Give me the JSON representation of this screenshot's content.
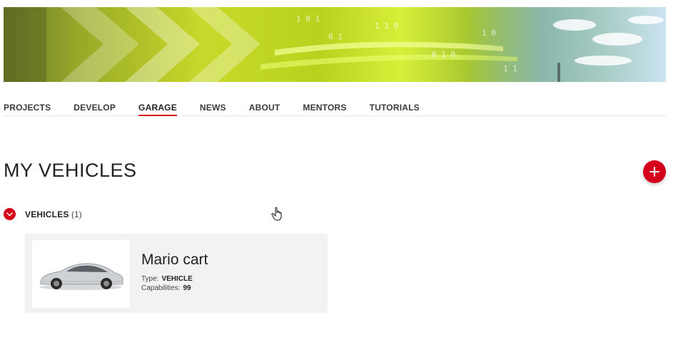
{
  "nav": {
    "items": [
      {
        "label": "PROJECTS"
      },
      {
        "label": "DEVELOP"
      },
      {
        "label": "GARAGE"
      },
      {
        "label": "NEWS"
      },
      {
        "label": "ABOUT"
      },
      {
        "label": "MENTORS"
      },
      {
        "label": "TUTORIALS"
      }
    ],
    "active": "GARAGE"
  },
  "page": {
    "title": "MY VEHICLES"
  },
  "add_button": {
    "icon": "plus-icon",
    "color": "#d5001c"
  },
  "section": {
    "label": "VEHICLES",
    "count": "(1)",
    "toggle_icon": "chevron-down-icon"
  },
  "vehicles": [
    {
      "name": "Mario cart",
      "type_label": "Type:",
      "type_value": "VEHICLE",
      "capabilities_label": "Capabilities:",
      "capabilities_value": "99",
      "image_icon": "car-image"
    }
  ],
  "colors": {
    "accent": "#d5001c",
    "card_bg": "#f2f2f2"
  }
}
